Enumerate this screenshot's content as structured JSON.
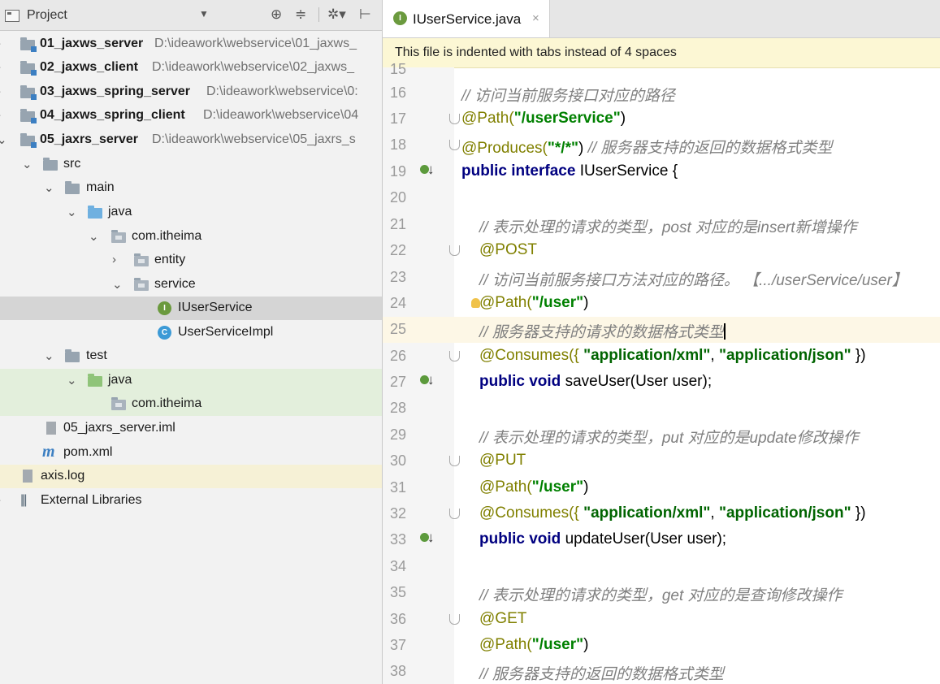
{
  "project_panel": {
    "title": "Project",
    "dropdown_icon": "▼",
    "toolbar": [
      "⊕",
      "≑",
      "✲▾",
      "⊢"
    ]
  },
  "tree": [
    {
      "label": "01_jaxws_server",
      "path": "D:\\ideawork\\webservice\\01_jaxws_",
      "bold": true
    },
    {
      "label": "02_jaxws_client",
      "path": "D:\\ideawork\\webservice\\02_jaxws_",
      "bold": true
    },
    {
      "label": "03_jaxws_spring_server",
      "path": "D:\\ideawork\\webservice\\0:",
      "bold": true
    },
    {
      "label": "04_jaxws_spring_client",
      "path": "D:\\ideawork\\webservice\\04",
      "bold": true
    },
    {
      "label": "05_jaxrs_server",
      "path": "D:\\ideawork\\webservice\\05_jaxrs_s",
      "bold": true
    },
    {
      "label": "src"
    },
    {
      "label": "main"
    },
    {
      "label": "java"
    },
    {
      "label": "com.itheima"
    },
    {
      "label": "entity"
    },
    {
      "label": "service"
    },
    {
      "label": "IUserService"
    },
    {
      "label": "UserServiceImpl"
    },
    {
      "label": "test"
    },
    {
      "label": "java"
    },
    {
      "label": "com.itheima"
    },
    {
      "label": "05_jaxrs_server.iml"
    },
    {
      "label": "pom.xml"
    },
    {
      "label": "axis.log"
    },
    {
      "label": "External Libraries"
    }
  ],
  "editor": {
    "tab_label": "IUserService.java",
    "tab_close": "×",
    "notice": "This file is indented with tabs instead of 4 spaces",
    "lines": [
      {
        "n": "15",
        "text": ""
      },
      {
        "n": "16",
        "text": "// 访问当前服务接口对应的路径"
      },
      {
        "n": "17",
        "a": "@Path(",
        "s": "\"/userService\"",
        "b": ")"
      },
      {
        "n": "18",
        "a": "@Produces(",
        "s": "\"*/*\"",
        "b": ") ",
        "c": "// 服务器支持的返回的数据格式类型"
      },
      {
        "n": "19",
        "k": "public interface ",
        "p": "IUserService {"
      },
      {
        "n": "20",
        "text": ""
      },
      {
        "n": "21",
        "text": "// 表示处理的请求的类型，post 对应的是insert新增操作"
      },
      {
        "n": "22",
        "a": "@POST"
      },
      {
        "n": "23",
        "text": "// 访问当前服务接口方法对应的路径。 【.../userService/user】"
      },
      {
        "n": "24",
        "a": "@Path(",
        "s": "\"/user\"",
        "b": ")"
      },
      {
        "n": "25",
        "text": "// 服务器支持的请求的数据格式类型"
      },
      {
        "n": "26",
        "a": "@Consumes({ ",
        "s": "\"application/xml\"",
        "b": ", ",
        "s2": "\"application/json\"",
        "b2": " })"
      },
      {
        "n": "27",
        "k": "public void ",
        "p": "saveUser(User user);"
      },
      {
        "n": "28",
        "text": ""
      },
      {
        "n": "29",
        "text": "// 表示处理的请求的类型，put 对应的是update修改操作"
      },
      {
        "n": "30",
        "a": "@PUT"
      },
      {
        "n": "31",
        "a": "@Path(",
        "s": "\"/user\"",
        "b": ")"
      },
      {
        "n": "32",
        "a": "@Consumes({ ",
        "s": "\"application/xml\"",
        "b": ", ",
        "s2": "\"application/json\"",
        "b2": " })"
      },
      {
        "n": "33",
        "k": "public void ",
        "p": "updateUser(User user);"
      },
      {
        "n": "34",
        "text": ""
      },
      {
        "n": "35",
        "text": "// 表示处理的请求的类型，get 对应的是查询修改操作"
      },
      {
        "n": "36",
        "a": "@GET"
      },
      {
        "n": "37",
        "a": "@Path(",
        "s": "\"/user\"",
        "b": ")"
      },
      {
        "n": "38",
        "text": "// 服务器支持的返回的数据格式类型"
      }
    ]
  },
  "colors": {
    "keyword": "#000080",
    "annotation": "#808000",
    "string": "#008000",
    "comment": "#808080",
    "notice_bg": "#fcf7d4",
    "selected_row": "#d5d5d5"
  }
}
